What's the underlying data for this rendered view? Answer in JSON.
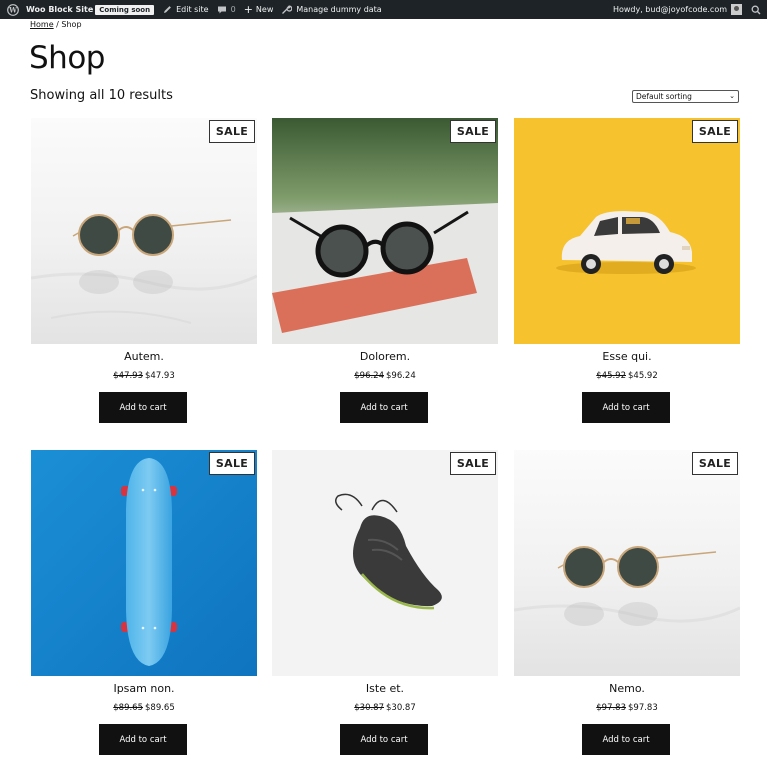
{
  "admin_bar": {
    "site_name": "Woo Block Site",
    "badge": "Coming soon",
    "edit_site": "Edit site",
    "comments_count": "0",
    "new_label": "New",
    "manage_label": "Manage dummy data",
    "greeting": "Howdy, bud@joyofcode.com",
    "bg_color": "#1d2327"
  },
  "breadcrumb": {
    "home": "Home",
    "separator": " / ",
    "current": "Shop"
  },
  "page": {
    "title": "Shop",
    "result_count": "Showing all 10 results"
  },
  "sort": {
    "selected": "Default sorting"
  },
  "products": [
    {
      "name": "Autem.",
      "old_price": "$47.93",
      "price": "$47.93",
      "badge": "SALE",
      "button": "Add to cart",
      "image": "sunglasses-marble"
    },
    {
      "name": "Dolorem.",
      "old_price": "$96.24",
      "price": "$96.24",
      "badge": "SALE",
      "button": "Add to cart",
      "image": "sunglasses-supreme"
    },
    {
      "name": "Esse qui.",
      "old_price": "$45.92",
      "price": "$45.92",
      "badge": "SALE",
      "button": "Add to cart",
      "image": "toy-car-yellow"
    },
    {
      "name": "Ipsam non.",
      "old_price": "$89.65",
      "price": "$89.65",
      "badge": "SALE",
      "button": "Add to cart",
      "image": "skateboard-blue"
    },
    {
      "name": "Iste et.",
      "old_price": "$30.87",
      "price": "$30.87",
      "badge": "SALE",
      "button": "Add to cart",
      "image": "sneaker"
    },
    {
      "name": "Nemo.",
      "old_price": "$97.83",
      "price": "$97.83",
      "badge": "SALE",
      "button": "Add to cart",
      "image": "sunglasses-marble"
    }
  ]
}
